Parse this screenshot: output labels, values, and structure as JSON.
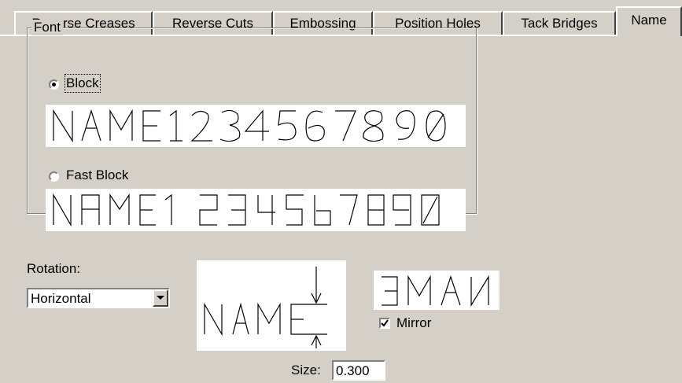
{
  "tabs": [
    {
      "label": "Reverse Creases",
      "active": false
    },
    {
      "label": "Reverse Cuts",
      "active": false
    },
    {
      "label": "Embossing",
      "active": false
    },
    {
      "label": "Position Holes",
      "active": false
    },
    {
      "label": "Tack Bridges",
      "active": false
    },
    {
      "label": "Name",
      "active": true
    }
  ],
  "font_group": {
    "legend": "Font",
    "options": [
      {
        "label": "Block",
        "selected": true,
        "preview_text": "NAME1234567890"
      },
      {
        "label": "Fast Block",
        "selected": false,
        "preview_text": "NAME1234567890"
      }
    ]
  },
  "rotation": {
    "label": "Rotation:",
    "selected": "Horizontal"
  },
  "size_preview": {
    "text": "NAME"
  },
  "mirror": {
    "label": "Mirror",
    "checked": true,
    "preview_text": "EMAN"
  },
  "size": {
    "label": "Size:",
    "value": "0.300"
  }
}
